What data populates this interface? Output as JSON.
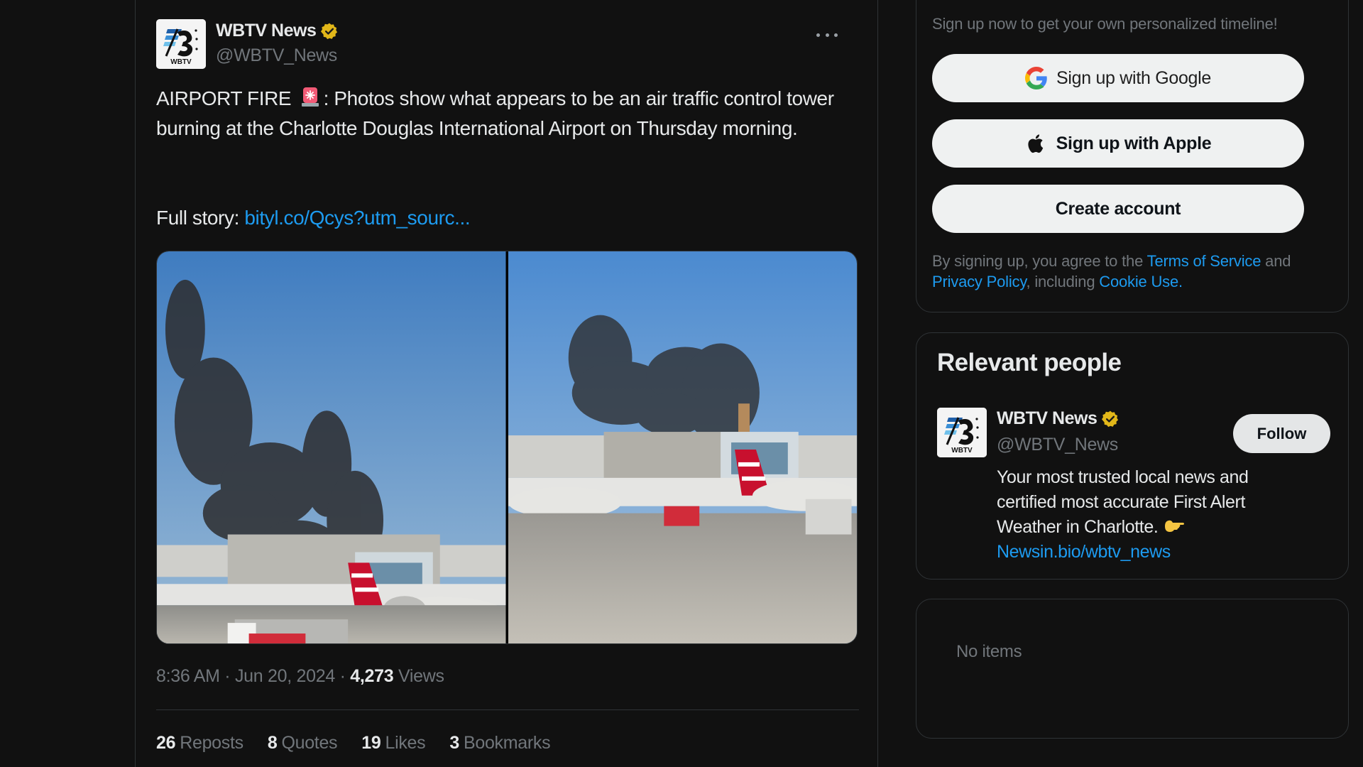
{
  "tweet": {
    "author": {
      "name": "WBTV News",
      "handle": "@WBTV_News",
      "verified": true,
      "avatar_icon": "wbtv-logo-icon"
    },
    "more_icon": "more-horizontal-icon",
    "text_prefix": "AIRPORT FIRE",
    "text_emoji": "siren-icon",
    "text_body": ": Photos show what appears to be an air traffic control tower burning at the Charlotte Douglas International Airport on Thursday morning.",
    "link_label": "Full story: ",
    "link_text": "bityl.co/Qcys?utm_sourc...",
    "media": [
      {
        "description": "Black smoke rising from air traffic control tower behind parked regional jets and ground vehicles"
      },
      {
        "description": "Smoke plume over airport terminal with American Eagle jet and red tug in foreground"
      }
    ],
    "time": "8:36 AM",
    "date": "Jun 20, 2024",
    "separator": " · ",
    "views_count": "4,273",
    "views_label": " Views",
    "stats": [
      {
        "count": "26",
        "label": "Reposts"
      },
      {
        "count": "8",
        "label": "Quotes"
      },
      {
        "count": "19",
        "label": "Likes"
      },
      {
        "count": "3",
        "label": "Bookmarks"
      }
    ]
  },
  "sidebar": {
    "signup": {
      "subtitle": "Sign up now to get your own personalized timeline!",
      "google_button": "Sign up with Google",
      "apple_button": "Sign up with Apple",
      "create_button": "Create account",
      "legal_prefix": "By signing up, you agree to the ",
      "terms_link": "Terms of Service",
      "legal_and": " and ",
      "privacy_link": "Privacy Policy",
      "legal_including": ", including ",
      "cookie_link": "Cookie Use."
    },
    "relevant_people": {
      "title": "Relevant people",
      "person": {
        "name": "WBTV News",
        "handle": "@WBTV_News",
        "verified": true,
        "follow_label": "Follow",
        "bio": "Your most trusted local news and certified most accurate First Alert Weather in Charlotte. ",
        "bio_emoji": "pointing-hand-icon",
        "bio_link": "Newsin.bio/wbtv_news"
      }
    },
    "empty_card": {
      "text": "No items"
    }
  },
  "colors": {
    "background": "#111111",
    "border": "#2f3336",
    "text_primary": "#e7e9ea",
    "text_secondary": "#71767b",
    "link": "#1d9bf0",
    "button_bg": "#eff1f1",
    "verified_badge": "#e2b719"
  }
}
